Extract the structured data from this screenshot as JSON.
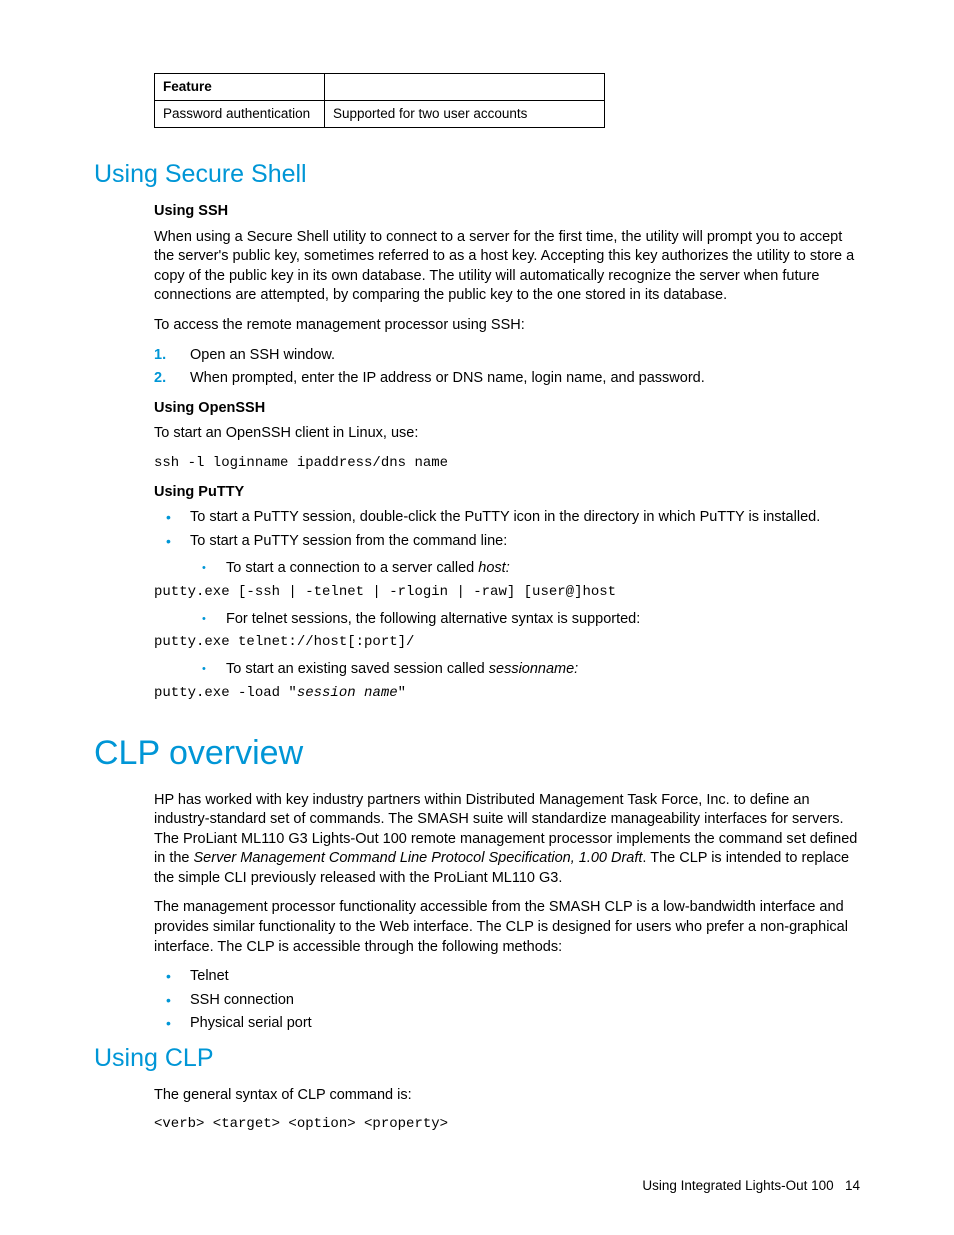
{
  "table": {
    "header": "Feature",
    "row_label": "Password authentication",
    "row_value": "Supported for two user accounts"
  },
  "s1": {
    "title": "Using Secure Shell",
    "ssh_heading": "Using SSH",
    "ssh_para": "When using a Secure Shell utility to connect to a server for the first time, the utility will prompt you to accept the server's public key, sometimes referred to as a host key. Accepting this key authorizes the utility to store a copy of the public key in its own database. The utility will automatically recognize the server when future connections are attempted, by comparing the public key to the one stored in its database.",
    "ssh_access": "To access the remote management processor using SSH:",
    "step1": "Open an SSH window.",
    "step2": "When prompted, enter the IP address or DNS name, login name, and password.",
    "openssh_heading": "Using OpenSSH",
    "openssh_para": "To start an OpenSSH client in Linux, use:",
    "openssh_cmd": "ssh -l loginname ipaddress/dns name",
    "putty_heading": "Using PuTTY",
    "putty_b1": "To start a PuTTY session, double-click the PuTTY icon in the directory in which PuTTY is installed.",
    "putty_b2": "To start a PuTTY session from the command line:",
    "putty_sub1_pre": "To start a connection to a server called ",
    "putty_sub1_ital": "host:",
    "putty_cmd1": "putty.exe [-ssh | -telnet | -rlogin | -raw] [user@]host",
    "putty_sub2": "For telnet sessions, the following alternative syntax is supported:",
    "putty_cmd2": "putty.exe telnet://host[:port]/",
    "putty_sub3_pre": "To start an existing saved session called ",
    "putty_sub3_ital": "sessionname:",
    "putty_cmd3_a": "putty.exe -load \"",
    "putty_cmd3_b": "session name",
    "putty_cmd3_c": "\""
  },
  "s2": {
    "title": "CLP overview",
    "para1_a": "HP has worked with key industry partners within Distributed Management Task Force, Inc. to define an industry-standard set of commands. The SMASH suite will standardize manageability interfaces for servers. The ProLiant ML110 G3 Lights-Out 100 remote management processor implements the command set defined in the ",
    "para1_ital": "Server Management Command Line Protocol Specification, 1.00 Draft",
    "para1_b": ". The CLP is intended to replace the simple CLI previously released with the ProLiant ML110 G3.",
    "para2": "The management processor functionality accessible from the SMASH CLP is a low-bandwidth interface and provides similar functionality to the Web interface. The CLP is designed for users who prefer a non-graphical interface. The CLP is accessible through the following methods:",
    "li1": "Telnet",
    "li2": "SSH connection",
    "li3": "Physical serial port"
  },
  "s3": {
    "title": "Using CLP",
    "para": "The general syntax of CLP command is:",
    "cmd": "<verb> <target> <option> <property>"
  },
  "footer": {
    "text": "Using Integrated Lights-Out 100",
    "page": "14"
  }
}
